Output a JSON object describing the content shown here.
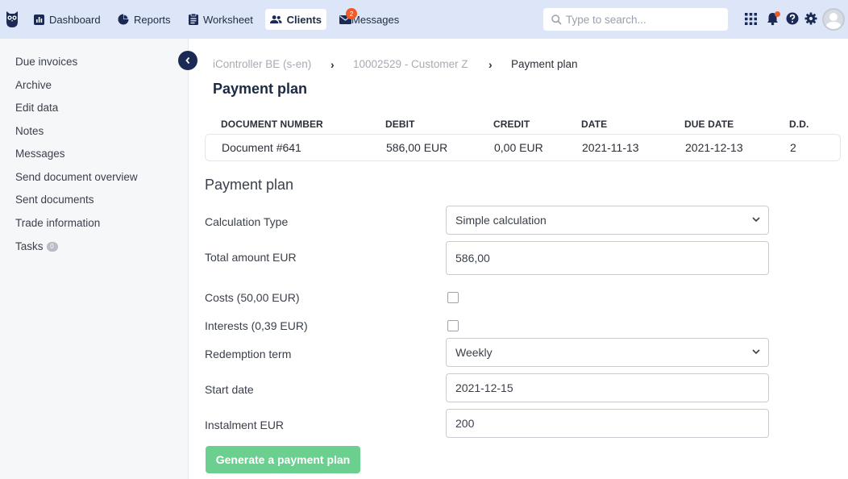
{
  "nav": {
    "items": [
      {
        "label": "Dashboard",
        "icon": "bar-chart-icon"
      },
      {
        "label": "Reports",
        "icon": "pie-chart-icon"
      },
      {
        "label": "Worksheet",
        "icon": "clipboard-icon"
      },
      {
        "label": "Clients",
        "icon": "users-icon",
        "active": true
      },
      {
        "label": "Messages",
        "icon": "envelope-icon",
        "badge": "2"
      }
    ],
    "search_placeholder": "Type to search...",
    "right_icons": [
      "apps-grid-icon",
      "bell-icon",
      "help-icon",
      "gear-icon",
      "user-avatar"
    ]
  },
  "sidebar": {
    "items": [
      {
        "label": "Due invoices"
      },
      {
        "label": "Archive"
      },
      {
        "label": "Edit data"
      },
      {
        "label": "Notes"
      },
      {
        "label": "Messages"
      },
      {
        "label": "Send document overview"
      },
      {
        "label": "Sent documents"
      },
      {
        "label": "Trade information"
      },
      {
        "label": "Tasks",
        "count": "0"
      }
    ]
  },
  "breadcrumb": {
    "items": [
      "iController BE (s-en)",
      "10002529 - Customer Z",
      "Payment plan"
    ]
  },
  "page_title": "Payment plan",
  "documents_table": {
    "headers": [
      "DOCUMENT NUMBER",
      "DEBIT",
      "CREDIT",
      "DATE",
      "DUE DATE",
      "D.D."
    ],
    "rows": [
      [
        "Document #641",
        "586,00 EUR",
        "0,00 EUR",
        "2021-11-13",
        "2021-12-13",
        "2"
      ]
    ]
  },
  "form": {
    "section_title": "Payment plan",
    "calculation_type": {
      "label": "Calculation Type",
      "value": "Simple calculation"
    },
    "total_amount": {
      "label": "Total amount EUR",
      "value": "586,00"
    },
    "costs": {
      "label": "Costs (50,00 EUR)",
      "checked": false
    },
    "interests": {
      "label": "Interests (0,39 EUR)",
      "checked": false
    },
    "redemption_term": {
      "label": "Redemption term",
      "value": "Weekly"
    },
    "start_date": {
      "label": "Start date",
      "value": "2021-12-15"
    },
    "instalment": {
      "label": "Instalment EUR",
      "value": "200"
    },
    "submit_label": "Generate a payment plan"
  },
  "colors": {
    "topbar_bg": "#dde6f8",
    "accent_navy": "#1b2a55",
    "badge_orange": "#f05a28",
    "button_green": "#6bd08f"
  }
}
